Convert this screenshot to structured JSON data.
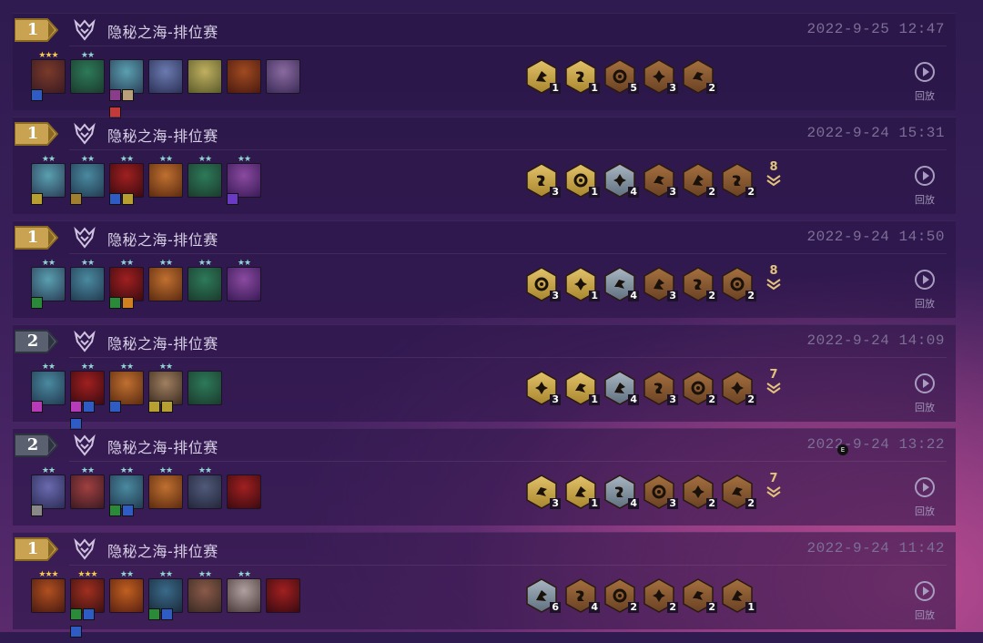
{
  "colors": {
    "accent_gold": "#e3c27a",
    "gold_rank": "#b9954a",
    "silver_rank": "#4a4f5e"
  },
  "matches": [
    {
      "rank": "1",
      "rank_tier": "gold",
      "mode": "隐秘之海-排位赛",
      "date": "2022-9-25 12:47",
      "units": [
        {
          "stars": 3,
          "star_color": "gold",
          "c": [
            "#7a3a2a",
            "#3a1a22"
          ],
          "items": [
            "#2f5cc4"
          ]
        },
        {
          "stars": 2,
          "star_color": "teal",
          "c": [
            "#2d7a5a",
            "#1b3a2c"
          ],
          "items": []
        },
        {
          "stars": 0,
          "star_color": "teal",
          "c": [
            "#5aa0b0",
            "#2a3d56"
          ],
          "items": [
            "#8a3b8a",
            "#b8a07a",
            "#c23a3a"
          ]
        },
        {
          "stars": 0,
          "star_color": "teal",
          "c": [
            "#6a7ab0",
            "#2c3156"
          ],
          "items": []
        },
        {
          "stars": 0,
          "star_color": "teal",
          "c": [
            "#c0b060",
            "#5a5a2a"
          ],
          "items": []
        },
        {
          "stars": 0,
          "star_color": "teal",
          "c": [
            "#a04a20",
            "#4a1a10"
          ],
          "items": []
        },
        {
          "stars": 0,
          "star_color": "teal",
          "c": [
            "#8a6aa0",
            "#3a2a56"
          ],
          "items": []
        }
      ],
      "traits": [
        {
          "tier": "gold",
          "n": "1"
        },
        {
          "tier": "gold",
          "n": "1"
        },
        {
          "tier": "bronze",
          "n": "5"
        },
        {
          "tier": "bronze",
          "n": "3"
        },
        {
          "tier": "bronze",
          "n": "2"
        }
      ],
      "more": "",
      "replay_label": "回放"
    },
    {
      "rank": "1",
      "rank_tier": "gold",
      "mode": "隐秘之海-排位赛",
      "date": "2022-9-24 15:31",
      "units": [
        {
          "stars": 2,
          "star_color": "teal",
          "c": [
            "#5aa0b0",
            "#2a3d56"
          ],
          "items": [
            "#b8a030"
          ]
        },
        {
          "stars": 2,
          "star_color": "teal",
          "c": [
            "#4a8aa0",
            "#223a50"
          ],
          "items": [
            "#a08030"
          ]
        },
        {
          "stars": 2,
          "star_color": "teal",
          "c": [
            "#a02020",
            "#3a0a10"
          ],
          "items": [
            "#2f5cc4",
            "#b8a030"
          ]
        },
        {
          "stars": 2,
          "star_color": "teal",
          "c": [
            "#c07030",
            "#5a2a10"
          ],
          "items": []
        },
        {
          "stars": 2,
          "star_color": "teal",
          "c": [
            "#2d7a5a",
            "#1b3a2c"
          ],
          "items": []
        },
        {
          "stars": 2,
          "star_color": "teal",
          "c": [
            "#8a4aa0",
            "#3a1a56"
          ],
          "items": [
            "#6a3ac4"
          ]
        }
      ],
      "traits": [
        {
          "tier": "gold",
          "n": "3"
        },
        {
          "tier": "gold",
          "n": "1"
        },
        {
          "tier": "silver",
          "n": "4"
        },
        {
          "tier": "bronze",
          "n": "3"
        },
        {
          "tier": "bronze",
          "n": "2"
        },
        {
          "tier": "bronze",
          "n": "2"
        }
      ],
      "more": "8",
      "replay_label": "回放"
    },
    {
      "rank": "1",
      "rank_tier": "gold",
      "mode": "隐秘之海-排位赛",
      "date": "2022-9-24 14:50",
      "units": [
        {
          "stars": 2,
          "star_color": "teal",
          "c": [
            "#5aa0b0",
            "#2a3d56"
          ],
          "items": [
            "#2a8a3a"
          ]
        },
        {
          "stars": 2,
          "star_color": "teal",
          "c": [
            "#4a8aa0",
            "#223a50"
          ],
          "items": []
        },
        {
          "stars": 2,
          "star_color": "teal",
          "c": [
            "#a02020",
            "#3a0a10"
          ],
          "items": [
            "#2a8a3a",
            "#d08020"
          ]
        },
        {
          "stars": 2,
          "star_color": "teal",
          "c": [
            "#c07030",
            "#5a2a10"
          ],
          "items": []
        },
        {
          "stars": 2,
          "star_color": "teal",
          "c": [
            "#2d7a5a",
            "#1b3a2c"
          ],
          "items": []
        },
        {
          "stars": 2,
          "star_color": "teal",
          "c": [
            "#8a4aa0",
            "#3a1a56"
          ],
          "items": []
        }
      ],
      "traits": [
        {
          "tier": "gold",
          "n": "3"
        },
        {
          "tier": "gold",
          "n": "1"
        },
        {
          "tier": "silver",
          "n": "4"
        },
        {
          "tier": "bronze",
          "n": "3"
        },
        {
          "tier": "bronze",
          "n": "2"
        },
        {
          "tier": "bronze",
          "n": "2"
        }
      ],
      "more": "8",
      "replay_label": "回放"
    },
    {
      "rank": "2",
      "rank_tier": "silver",
      "mode": "隐秘之海-排位赛",
      "date": "2022-9-24 14:09",
      "units": [
        {
          "stars": 2,
          "star_color": "teal",
          "c": [
            "#4a8aa0",
            "#223a50"
          ],
          "items": [
            "#b83ab8"
          ]
        },
        {
          "stars": 2,
          "star_color": "teal",
          "c": [
            "#a02020",
            "#3a0a10"
          ],
          "items": [
            "#b83ab8",
            "#2f5cc4",
            "#2f5cc4"
          ]
        },
        {
          "stars": 2,
          "star_color": "teal",
          "c": [
            "#c07030",
            "#5a2a10"
          ],
          "items": [
            "#2f5cc4"
          ]
        },
        {
          "stars": 2,
          "star_color": "teal",
          "c": [
            "#a08060",
            "#3a2a20"
          ],
          "items": [
            "#b8a030",
            "#b8a030"
          ]
        },
        {
          "stars": 0,
          "star_color": "teal",
          "c": [
            "#2d7a5a",
            "#1b3a2c"
          ],
          "items": []
        }
      ],
      "traits": [
        {
          "tier": "gold",
          "n": "3"
        },
        {
          "tier": "gold",
          "n": "1"
        },
        {
          "tier": "silver",
          "n": "4"
        },
        {
          "tier": "bronze",
          "n": "3"
        },
        {
          "tier": "bronze",
          "n": "2"
        },
        {
          "tier": "bronze",
          "n": "2"
        }
      ],
      "more": "7",
      "replay_label": "回放"
    },
    {
      "rank": "2",
      "rank_tier": "silver",
      "mode": "隐秘之海-排位赛",
      "date": "2022-9-24 13:22",
      "units": [
        {
          "stars": 2,
          "star_color": "teal",
          "c": [
            "#6a6ab0",
            "#2c2c56"
          ],
          "items": [
            "#888888"
          ]
        },
        {
          "stars": 2,
          "star_color": "teal",
          "c": [
            "#a04040",
            "#3a1a22"
          ],
          "items": []
        },
        {
          "stars": 2,
          "star_color": "teal",
          "c": [
            "#4a8aa0",
            "#223a50"
          ],
          "items": [
            "#2a8a3a",
            "#2f5cc4"
          ]
        },
        {
          "stars": 2,
          "star_color": "teal",
          "c": [
            "#c07030",
            "#5a2a10"
          ],
          "items": []
        },
        {
          "stars": 2,
          "star_color": "teal",
          "c": [
            "#505a7a",
            "#23263a"
          ],
          "items": []
        },
        {
          "stars": 0,
          "star_color": "teal",
          "c": [
            "#a02020",
            "#3a0a10"
          ],
          "items": []
        }
      ],
      "traits": [
        {
          "tier": "gold",
          "n": "3"
        },
        {
          "tier": "gold",
          "n": "1"
        },
        {
          "tier": "silver",
          "n": "4"
        },
        {
          "tier": "bronze",
          "n": "3"
        },
        {
          "tier": "bronze",
          "n": "2"
        },
        {
          "tier": "bronze",
          "n": "2"
        }
      ],
      "more": "7",
      "replay_label": "回放"
    },
    {
      "rank": "1",
      "rank_tier": "gold",
      "mode": "隐秘之海-排位赛",
      "date": "2022-9-24 11:42",
      "units": [
        {
          "stars": 3,
          "star_color": "gold",
          "c": [
            "#b05020",
            "#4a1a10"
          ],
          "items": []
        },
        {
          "stars": 3,
          "star_color": "gold",
          "c": [
            "#a03020",
            "#3a1010"
          ],
          "items": [
            "#2a8a3a",
            "#2f5cc4",
            "#2f5cc4"
          ]
        },
        {
          "stars": 2,
          "star_color": "teal",
          "c": [
            "#c06020",
            "#5a2010"
          ],
          "items": []
        },
        {
          "stars": 2,
          "star_color": "teal",
          "c": [
            "#3a6a8a",
            "#1a2a3a"
          ],
          "items": [
            "#2a8a3a",
            "#2f5cc4"
          ]
        },
        {
          "stars": 2,
          "star_color": "teal",
          "c": [
            "#8a5a4a",
            "#3a2a22"
          ],
          "items": []
        },
        {
          "stars": 2,
          "star_color": "teal",
          "c": [
            "#b0a0a0",
            "#4a3a3a"
          ],
          "items": []
        },
        {
          "stars": 0,
          "star_color": "teal",
          "c": [
            "#a02020",
            "#3a0a10"
          ],
          "items": []
        }
      ],
      "traits": [
        {
          "tier": "silver",
          "n": "6"
        },
        {
          "tier": "bronze",
          "n": "4"
        },
        {
          "tier": "bronze",
          "n": "2"
        },
        {
          "tier": "bronze",
          "n": "2"
        },
        {
          "tier": "bronze",
          "n": "2"
        },
        {
          "tier": "bronze",
          "n": "1"
        }
      ],
      "more": "",
      "replay_label": "回放"
    }
  ]
}
